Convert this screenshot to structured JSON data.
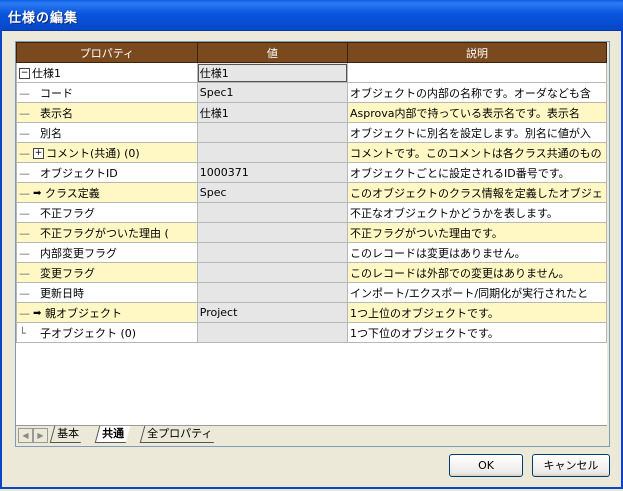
{
  "window": {
    "title": "仕様の編集"
  },
  "grid": {
    "headers": [
      "プロパティ",
      "値",
      "説明"
    ],
    "rows": [
      {
        "prop": "仕様1",
        "value": "仕様1",
        "desc": "",
        "style": "norm",
        "kind": "root"
      },
      {
        "prop": "コード",
        "value": "Spec1",
        "desc": "オブジェクトの内部の名称です。オーダなども含",
        "style": "norm",
        "kind": "child"
      },
      {
        "prop": "表示名",
        "value": "仕様1",
        "desc": "Asprova内部で持っている表示名です。表示名",
        "style": "alt",
        "kind": "child"
      },
      {
        "prop": "別名",
        "value": "",
        "desc": "オブジェクトに別名を設定します。別名に値が入",
        "style": "norm",
        "kind": "child"
      },
      {
        "prop": "コメント(共通) (0)",
        "value": "",
        "desc": "コメントです。このコメントは各クラス共通のもの",
        "style": "alt",
        "kind": "expand"
      },
      {
        "prop": "オブジェクトID",
        "value": "1000371",
        "desc": "オブジェクトごとに設定されるID番号です。",
        "style": "norm",
        "kind": "child"
      },
      {
        "prop": "クラス定義",
        "value": "Spec",
        "desc": "このオブジェクトのクラス情報を定義したオブジェ",
        "style": "alt",
        "kind": "link"
      },
      {
        "prop": "不正フラグ",
        "value": "",
        "desc": "不正なオブジェクトかどうかを表します。",
        "style": "norm",
        "kind": "child"
      },
      {
        "prop": "不正フラグがついた理由 (",
        "value": "",
        "desc": "不正フラグがついた理由です。",
        "style": "alt",
        "kind": "child"
      },
      {
        "prop": "内部変更フラグ",
        "value": "",
        "desc": "このレコードは変更はありません。",
        "style": "norm",
        "kind": "child"
      },
      {
        "prop": "変更フラグ",
        "value": "",
        "desc": "このレコードは外部での変更はありません。",
        "style": "alt",
        "kind": "child"
      },
      {
        "prop": "更新日時",
        "value": "",
        "desc": "インポート/エクスポート/同期化が実行されたと",
        "style": "norm",
        "kind": "child"
      },
      {
        "prop": "親オブジェクト",
        "value": "Project",
        "desc": "1つ上位のオブジェクトです。",
        "style": "alt",
        "kind": "link"
      },
      {
        "prop": "子オブジェクト (0)",
        "value": "",
        "desc": "1つ下位のオブジェクトです。",
        "style": "norm",
        "kind": "last"
      }
    ]
  },
  "tabs": [
    "基本",
    "共通",
    "全プロパティ"
  ],
  "active_tab": "共通",
  "buttons": {
    "ok": "OK",
    "cancel": "キャンセル"
  },
  "colors": {
    "header": "#7a4a1e",
    "alt_row": "#fff8c4",
    "titlebar": "#0a55dd"
  }
}
